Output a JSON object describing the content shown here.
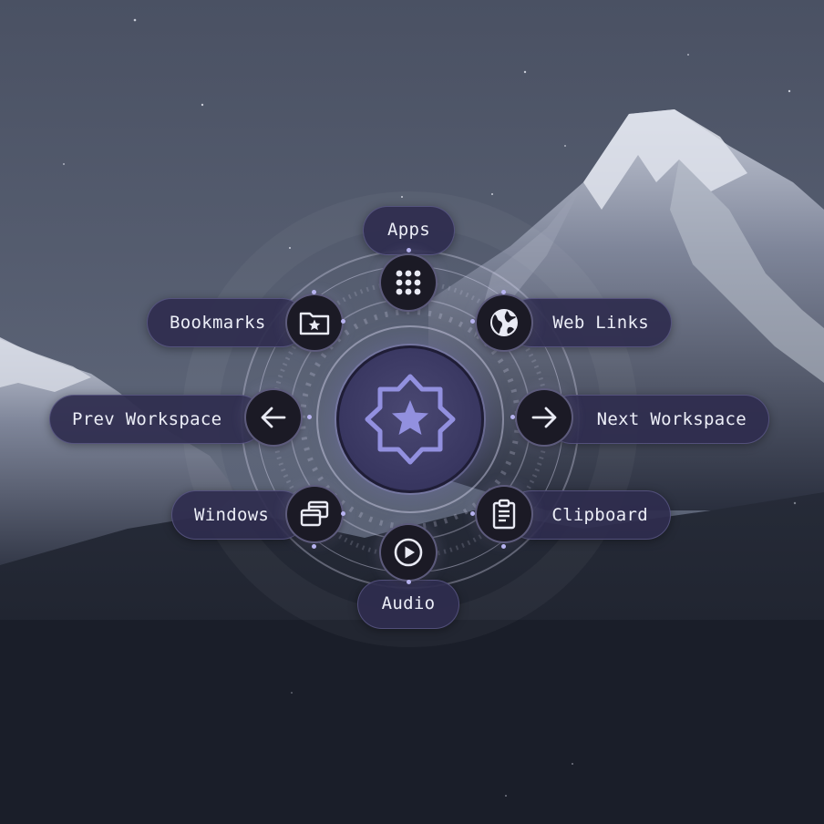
{
  "menu": {
    "items": {
      "apps": {
        "label": "Apps",
        "icon": "grid-icon"
      },
      "bookmarks": {
        "label": "Bookmarks",
        "icon": "folder-star-icon"
      },
      "web_links": {
        "label": "Web Links",
        "icon": "globe-icon"
      },
      "prev_workspace": {
        "label": "Prev Workspace",
        "icon": "arrow-left-icon"
      },
      "next_workspace": {
        "label": "Next Workspace",
        "icon": "arrow-right-icon"
      },
      "windows": {
        "label": "Windows",
        "icon": "windows-stack-icon"
      },
      "clipboard": {
        "label": "Clipboard",
        "icon": "clipboard-icon"
      },
      "audio": {
        "label": "Audio",
        "icon": "play-circle-icon"
      }
    },
    "center": {
      "icon": "star-badge-icon"
    }
  },
  "colors": {
    "pill_background": "#2f2c4e",
    "button_background": "#1b1a25",
    "accent": "#8f8ce0",
    "label_text": "#eceef7"
  }
}
